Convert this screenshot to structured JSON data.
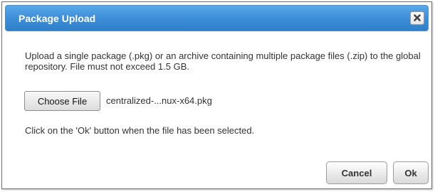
{
  "dialog": {
    "title": "Package Upload",
    "message": "Upload a single package (.pkg) or an archive containing multiple package files (.zip) to the global repository. File must not exceed 1.5 GB.",
    "choose_file_label": "Choose File",
    "file_name": "centralized-...nux-x64.pkg",
    "instruction": "Click on the 'Ok' button when the file has been selected.",
    "cancel_label": "Cancel",
    "ok_label": "Ok"
  },
  "icons": {
    "close": "close-icon"
  },
  "colors": {
    "titlebar": "#3d8ed8",
    "title_text": "#ffffff"
  }
}
